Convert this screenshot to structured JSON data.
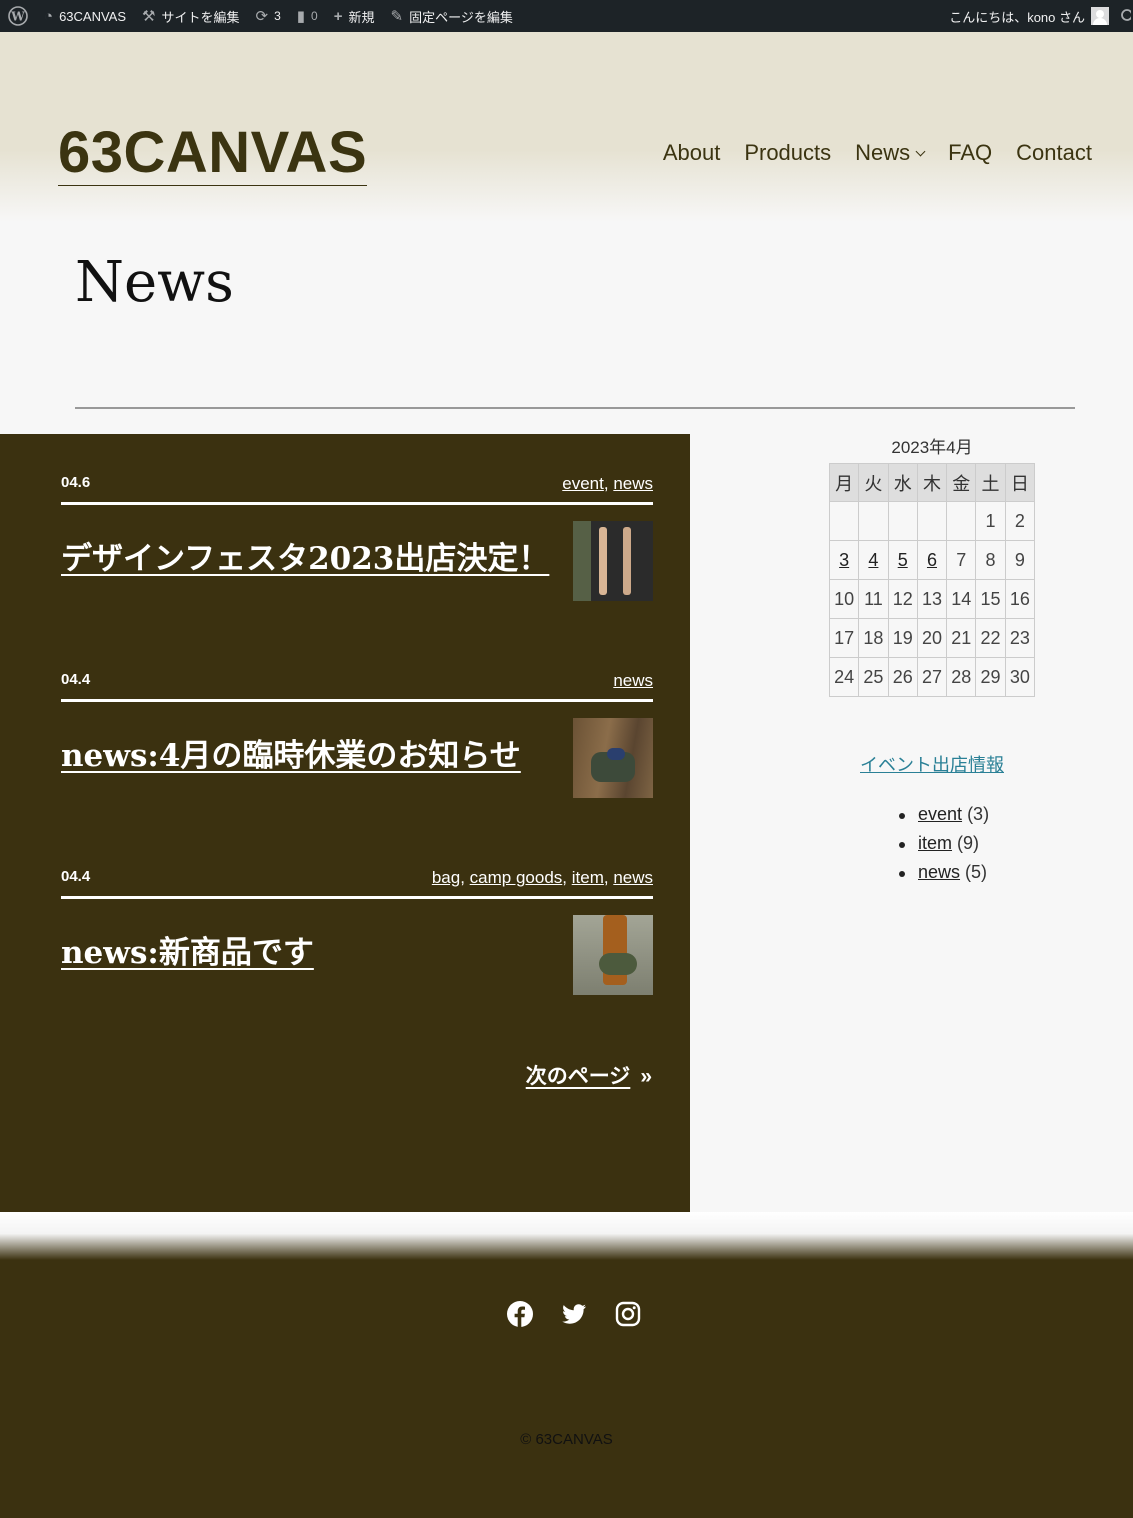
{
  "admin_bar": {
    "wp_logo": "wordpress-icon",
    "site_name": "63CANVAS",
    "edit_site": "サイトを編集",
    "updates_count": "3",
    "comments_count": "0",
    "new_label": "新規",
    "edit_page": "固定ページを編集",
    "greeting": "こんにちは、kono さん"
  },
  "header": {
    "site_title": "63CANVAS",
    "nav": [
      {
        "label": "About"
      },
      {
        "label": "Products"
      },
      {
        "label": "News"
      },
      {
        "label": "FAQ"
      },
      {
        "label": "Contact"
      }
    ]
  },
  "page": {
    "title": "News"
  },
  "posts": [
    {
      "date": "04.6",
      "categories": [
        "event",
        "news"
      ],
      "title": "デザインフェスタ2023出店決定！"
    },
    {
      "date": "04.4",
      "categories": [
        "news"
      ],
      "title": "news:4月の臨時休業のお知らせ"
    },
    {
      "date": "04.4",
      "categories": [
        "bag",
        "camp goods",
        "item",
        "news"
      ],
      "title": "news:新商品です"
    }
  ],
  "pagination": {
    "next_label": "次のページ",
    "next_arrow": "»"
  },
  "calendar": {
    "caption": "2023年4月",
    "weekdays": [
      "月",
      "火",
      "水",
      "木",
      "金",
      "土",
      "日"
    ],
    "rows": [
      [
        "",
        "",
        "",
        "",
        "",
        "1",
        "2"
      ],
      [
        "3",
        "4",
        "5",
        "6",
        "7",
        "8",
        "9"
      ],
      [
        "10",
        "11",
        "12",
        "13",
        "14",
        "15",
        "16"
      ],
      [
        "17",
        "18",
        "19",
        "20",
        "21",
        "22",
        "23"
      ],
      [
        "24",
        "25",
        "26",
        "27",
        "28",
        "29",
        "30"
      ]
    ],
    "linked_days": [
      "3",
      "4",
      "5",
      "6"
    ]
  },
  "sidebar": {
    "event_link": "イベント出店情報",
    "categories": [
      {
        "name": "event",
        "count": "(3)"
      },
      {
        "name": "item",
        "count": "(9)"
      },
      {
        "name": "news",
        "count": "(5)"
      }
    ]
  },
  "footer": {
    "social": [
      "facebook-icon",
      "twitter-icon",
      "instagram-icon"
    ],
    "copyright": "© 63CANVAS"
  },
  "colors": {
    "dark_olive": "#3b3110",
    "header_beige": "#e6e2d2",
    "link_teal": "#2a8096"
  }
}
